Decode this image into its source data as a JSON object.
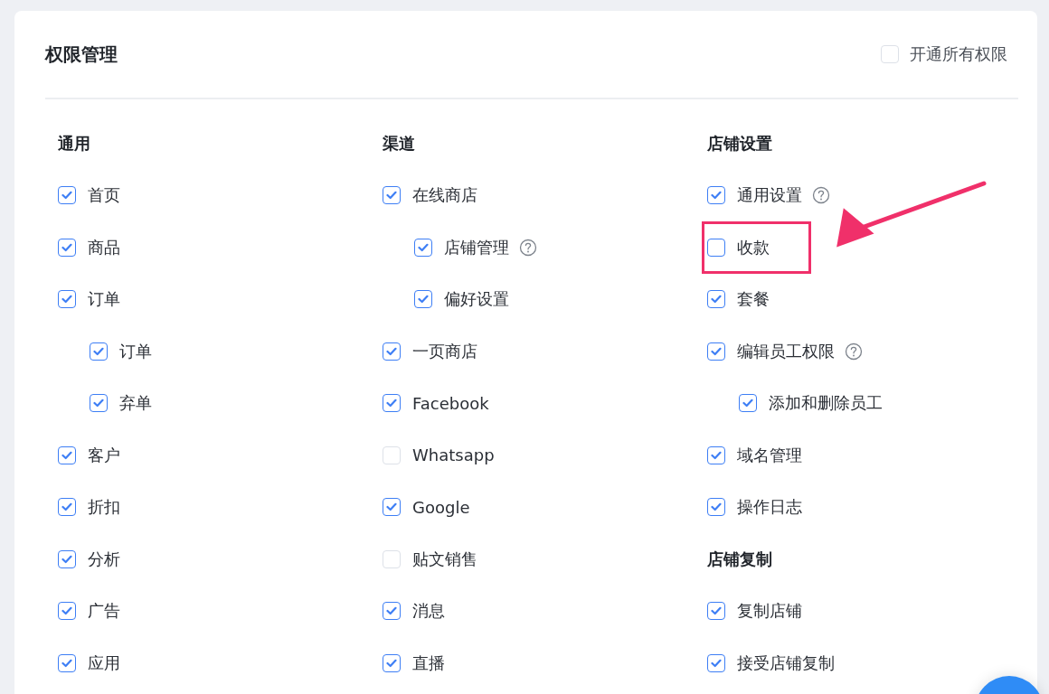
{
  "title": "权限管理",
  "grant_all": {
    "label": "开通所有权限",
    "checked": false
  },
  "columns": [
    {
      "sections": [
        {
          "title": "通用",
          "items": [
            {
              "label": "首页",
              "checked": true,
              "help": false,
              "highlighted": false
            },
            {
              "label": "商品",
              "checked": true,
              "help": false,
              "highlighted": false
            },
            {
              "label": "订单",
              "checked": true,
              "help": false,
              "highlighted": false,
              "children": [
                {
                  "label": "订单",
                  "checked": true,
                  "help": false,
                  "highlighted": false
                },
                {
                  "label": "弃单",
                  "checked": true,
                  "help": false,
                  "highlighted": false
                }
              ]
            },
            {
              "label": "客户",
              "checked": true,
              "help": false,
              "highlighted": false
            },
            {
              "label": "折扣",
              "checked": true,
              "help": false,
              "highlighted": false
            },
            {
              "label": "分析",
              "checked": true,
              "help": false,
              "highlighted": false
            },
            {
              "label": "广告",
              "checked": true,
              "help": false,
              "highlighted": false
            },
            {
              "label": "应用",
              "checked": true,
              "help": false,
              "highlighted": false
            }
          ]
        }
      ]
    },
    {
      "sections": [
        {
          "title": "渠道",
          "items": [
            {
              "label": "在线商店",
              "checked": true,
              "help": false,
              "highlighted": false,
              "children": [
                {
                  "label": "店铺管理",
                  "checked": true,
                  "help": true,
                  "highlighted": false
                },
                {
                  "label": "偏好设置",
                  "checked": true,
                  "help": false,
                  "highlighted": false
                }
              ]
            },
            {
              "label": "一页商店",
              "checked": true,
              "help": false,
              "highlighted": false
            },
            {
              "label": "Facebook",
              "checked": true,
              "help": false,
              "highlighted": false
            },
            {
              "label": "Whatsapp",
              "checked": false,
              "help": false,
              "highlighted": false
            },
            {
              "label": "Google",
              "checked": true,
              "help": false,
              "highlighted": false
            },
            {
              "label": "贴文销售",
              "checked": false,
              "help": false,
              "highlighted": false
            },
            {
              "label": "消息",
              "checked": true,
              "help": false,
              "highlighted": false
            },
            {
              "label": "直播",
              "checked": true,
              "help": false,
              "highlighted": false
            }
          ]
        }
      ]
    },
    {
      "sections": [
        {
          "title": "店铺设置",
          "items": [
            {
              "label": "通用设置",
              "checked": true,
              "help": true,
              "highlighted": false
            },
            {
              "label": "收款",
              "checked": false,
              "help": false,
              "highlighted": true
            },
            {
              "label": "套餐",
              "checked": true,
              "help": false,
              "highlighted": false
            },
            {
              "label": "编辑员工权限",
              "checked": true,
              "help": true,
              "highlighted": false,
              "children": [
                {
                  "label": "添加和删除员工",
                  "checked": true,
                  "help": false,
                  "highlighted": false
                }
              ]
            },
            {
              "label": "域名管理",
              "checked": true,
              "help": false,
              "highlighted": false
            },
            {
              "label": "操作日志",
              "checked": true,
              "help": false,
              "highlighted": false
            }
          ]
        },
        {
          "title": "店铺复制",
          "items": [
            {
              "label": "复制店铺",
              "checked": true,
              "help": false,
              "highlighted": false
            },
            {
              "label": "接受店铺复制",
              "checked": true,
              "help": false,
              "highlighted": false
            }
          ]
        }
      ]
    }
  ]
}
